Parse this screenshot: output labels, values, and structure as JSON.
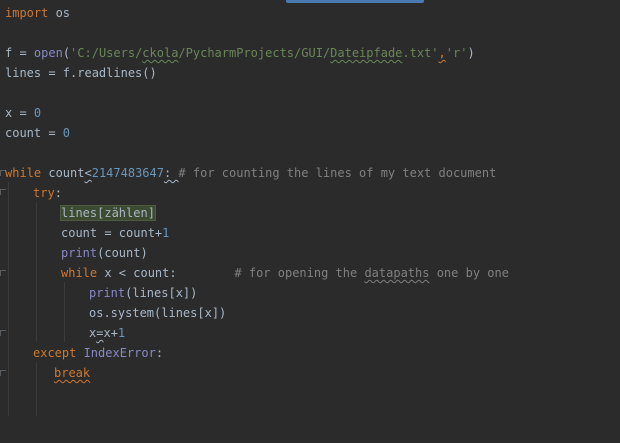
{
  "editor": {
    "line_import": {
      "kw": "import",
      "rest": " os"
    },
    "line_open": {
      "a": "f = ",
      "fn": "open",
      "b": "(",
      "s1": "'C:/Users/",
      "s2": "ckola",
      "s3": "/PycharmProjects/GUI/",
      "s4": "Dateipfade",
      "s5": ".txt'",
      "c": ",",
      "s6": "'r'",
      "d": ")"
    },
    "line_lines": "lines = f.readlines()",
    "line_x": {
      "a": "x = ",
      "n": "0"
    },
    "line_count": {
      "a": "count = ",
      "n": "0"
    },
    "line_while": {
      "kw": "while",
      "a": " count",
      "b": "<",
      "n": "2147483647",
      "c": ": ",
      "cmt": "# for counting the lines of my text document"
    },
    "line_try": {
      "kw": "try",
      "c": ":"
    },
    "line_lz": "lines[zählen]",
    "line_inc": {
      "a": "count = count+",
      "n": "1"
    },
    "line_print": {
      "fn": "print",
      "a": "(count)"
    },
    "line_while2": {
      "kw": "while",
      "a": " x < count:",
      "sp": "        ",
      "c1": "# for opening the ",
      "c2": "datapaths",
      "c3": " one by one"
    },
    "line_print2": {
      "fn": "print",
      "a": "(lines[x])"
    },
    "line_system": "os.system(lines[x])",
    "line_xinc": {
      "a": "x",
      "b": "=",
      "c": "x+",
      "n": "1"
    },
    "line_except": {
      "kw": "except",
      "exc": " IndexError",
      "c": ":"
    },
    "line_break": "break"
  },
  "colors": {
    "background": "#2b2b2b",
    "keyword": "#cc7832",
    "string": "#6a8759",
    "number": "#6897bb",
    "comment": "#808080",
    "builtin": "#8888c6",
    "text": "#a9b7c6"
  }
}
